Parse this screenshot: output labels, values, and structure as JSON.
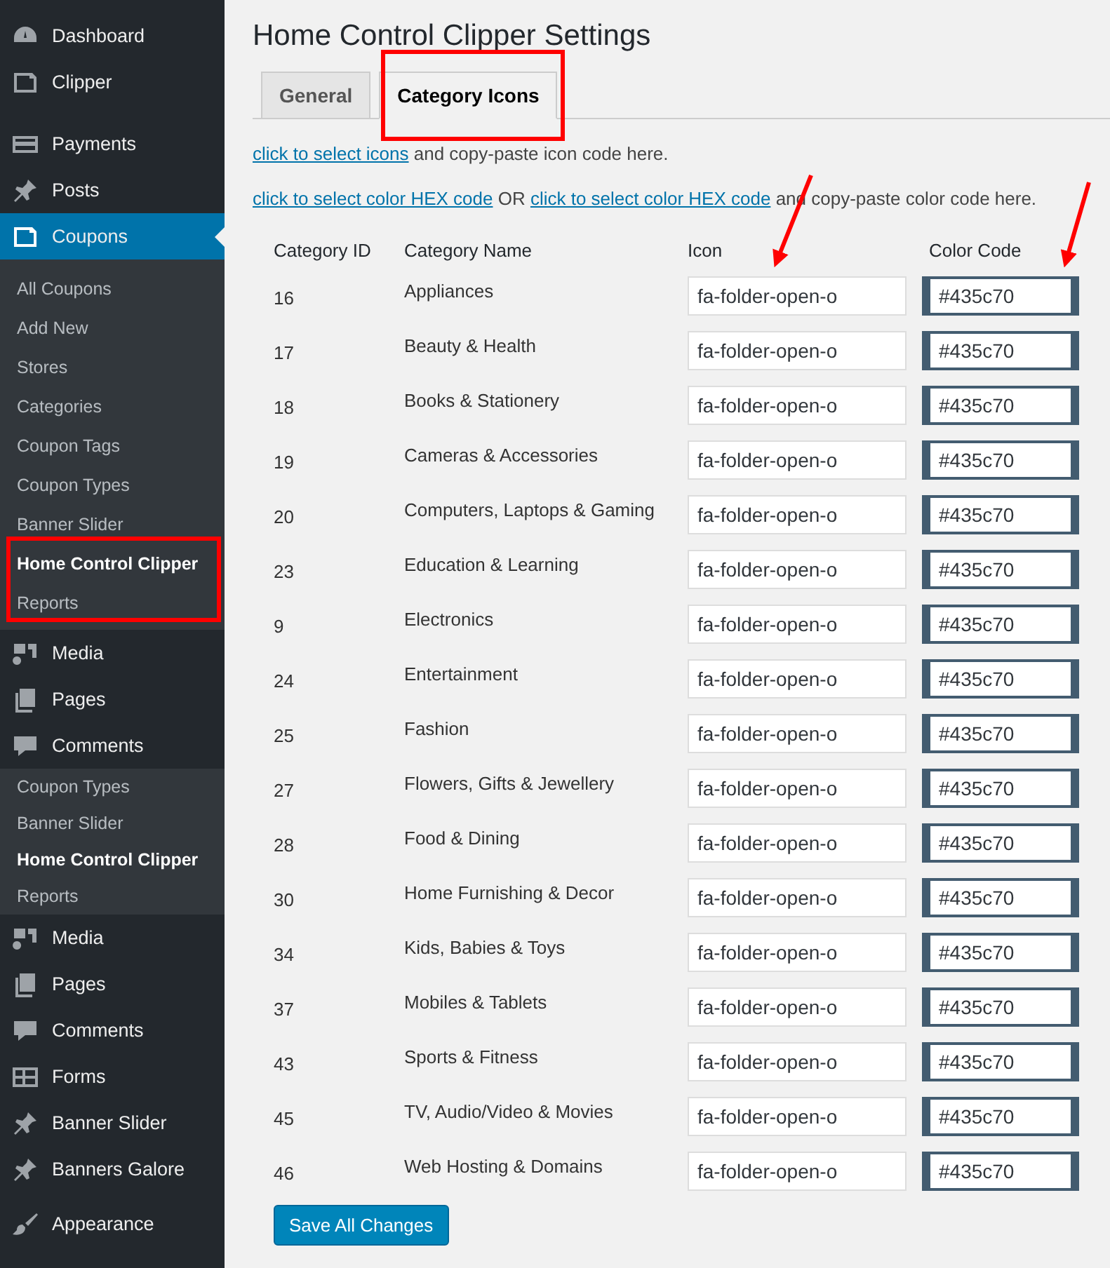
{
  "sidebar": [
    {
      "kind": "menu",
      "label": "Dashboard",
      "selected": false
    },
    {
      "kind": "menu",
      "label": "Clipper",
      "selected": false
    },
    {
      "kind": "separator"
    },
    {
      "kind": "menu",
      "label": "Payments",
      "selected": false
    },
    {
      "kind": "menu",
      "label": "Posts",
      "selected": false
    },
    {
      "kind": "menu",
      "label": "Coupons",
      "selected": true
    },
    {
      "kind": "submenu",
      "items": [
        {
          "label": "All Coupons",
          "selected": false
        },
        {
          "label": "Add New",
          "selected": false
        },
        {
          "label": "Stores",
          "selected": false
        },
        {
          "label": "Categories",
          "selected": false
        },
        {
          "label": "Coupon Tags",
          "selected": false
        },
        {
          "label": "Coupon Types",
          "selected": false
        },
        {
          "label": "Banner Slider",
          "selected": false
        },
        {
          "label": "Home Control Clipper",
          "selected": true
        },
        {
          "label": "Reports",
          "selected": false
        }
      ]
    },
    {
      "kind": "menu",
      "label": "Media",
      "selected": false
    },
    {
      "kind": "menu",
      "label": "Pages",
      "selected": false
    },
    {
      "kind": "menu",
      "label": "Comments",
      "selected": false
    },
    {
      "kind": "submenu",
      "items": [
        {
          "label": "Coupon Types",
          "selected": false
        },
        {
          "label": "Banner Slider",
          "selected": false
        },
        {
          "label": "Home Control Clipper",
          "selected": true
        },
        {
          "label": "Reports",
          "selected": false
        }
      ]
    },
    {
      "kind": "menu",
      "label": "Media",
      "selected": false
    },
    {
      "kind": "menu",
      "label": "Pages",
      "selected": false
    },
    {
      "kind": "menu",
      "label": "Comments",
      "selected": false
    },
    {
      "kind": "menu",
      "label": "Forms",
      "selected": false
    },
    {
      "kind": "menu",
      "label": "Banner Slider",
      "selected": false
    },
    {
      "kind": "menu",
      "label": "Banners Galore",
      "selected": false
    },
    {
      "kind": "separator"
    },
    {
      "kind": "menu",
      "label": "Appearance",
      "selected": false
    }
  ],
  "page": {
    "title": "Home Control Clipper Settings",
    "tabs": [
      {
        "label": "General",
        "selected": false
      },
      {
        "label": "Category Icons",
        "selected": true
      }
    ],
    "help": [
      [
        {
          "kind": "link",
          "text": "click to select icons"
        },
        {
          "kind": "text",
          "text": " and copy-paste icon code here."
        }
      ],
      [
        {
          "kind": "link",
          "text": "click to select color HEX code"
        },
        {
          "kind": "text",
          "text": " OR "
        },
        {
          "kind": "link",
          "text": "click to select color HEX code"
        },
        {
          "kind": "text",
          "text": " and copy-paste color code here."
        }
      ]
    ],
    "table": {
      "columns": [
        "Category ID",
        "Category Name",
        "Icon",
        "Color Code"
      ],
      "rows": [
        {
          "id": "16",
          "name": "Appliances",
          "icon": "fa-folder-open-o",
          "color": "#435c70"
        },
        {
          "id": "17",
          "name": "Beauty & Health",
          "icon": "fa-folder-open-o",
          "color": "#435c70"
        },
        {
          "id": "18",
          "name": "Books & Stationery",
          "icon": "fa-folder-open-o",
          "color": "#435c70"
        },
        {
          "id": "19",
          "name": "Cameras & Accessories",
          "icon": "fa-folder-open-o",
          "color": "#435c70"
        },
        {
          "id": "20",
          "name": "Computers, Laptops & Gaming",
          "icon": "fa-folder-open-o",
          "color": "#435c70"
        },
        {
          "id": "23",
          "name": "Education & Learning",
          "icon": "fa-folder-open-o",
          "color": "#435c70"
        },
        {
          "id": "9",
          "name": "Electronics",
          "icon": "fa-folder-open-o",
          "color": "#435c70"
        },
        {
          "id": "24",
          "name": "Entertainment",
          "icon": "fa-folder-open-o",
          "color": "#435c70"
        },
        {
          "id": "25",
          "name": "Fashion",
          "icon": "fa-folder-open-o",
          "color": "#435c70"
        },
        {
          "id": "27",
          "name": "Flowers, Gifts & Jewellery",
          "icon": "fa-folder-open-o",
          "color": "#435c70"
        },
        {
          "id": "28",
          "name": "Food & Dining",
          "icon": "fa-folder-open-o",
          "color": "#435c70"
        },
        {
          "id": "30",
          "name": "Home Furnishing & Decor",
          "icon": "fa-folder-open-o",
          "color": "#435c70"
        },
        {
          "id": "34",
          "name": "Kids, Babies & Toys",
          "icon": "fa-folder-open-o",
          "color": "#435c70"
        },
        {
          "id": "37",
          "name": "Mobiles & Tablets",
          "icon": "fa-folder-open-o",
          "color": "#435c70"
        },
        {
          "id": "43",
          "name": "Sports & Fitness",
          "icon": "fa-folder-open-o",
          "color": "#435c70"
        },
        {
          "id": "45",
          "name": "TV, Audio/Video & Movies",
          "icon": "fa-folder-open-o",
          "color": "#435c70"
        },
        {
          "id": "46",
          "name": "Web Hosting & Domains",
          "icon": "fa-folder-open-o",
          "color": "#435c70"
        }
      ]
    },
    "save_button": "Save All Changes"
  }
}
